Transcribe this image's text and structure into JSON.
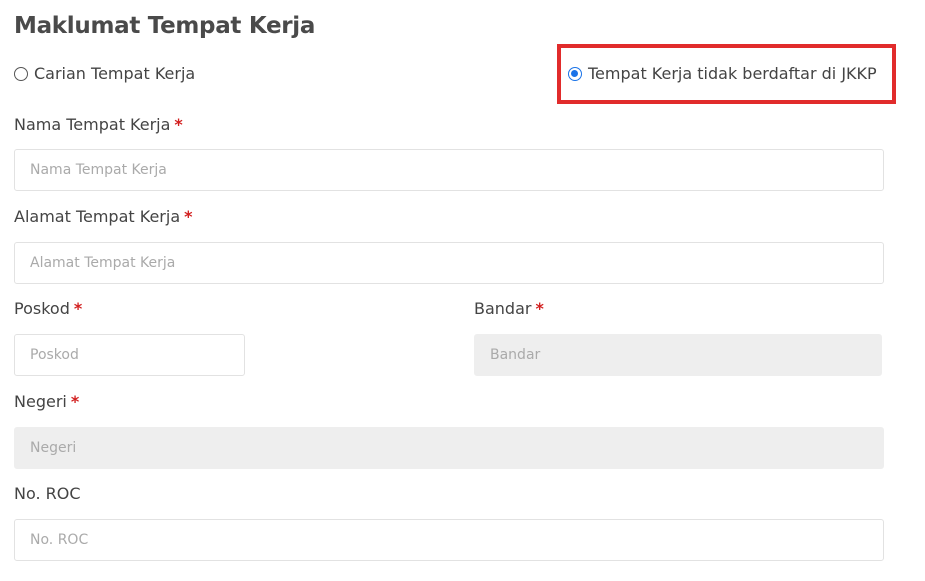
{
  "section": {
    "title": "Maklumat Tempat Kerja"
  },
  "workplace_options": {
    "search": {
      "label": "Carian Tempat Kerja",
      "checked": false
    },
    "unregistered": {
      "label": "Tempat Kerja tidak berdaftar di JKKP",
      "checked": true
    }
  },
  "fields": {
    "nama": {
      "label": "Nama Tempat Kerja",
      "required": "*",
      "placeholder": "Nama Tempat Kerja",
      "value": ""
    },
    "alamat": {
      "label": "Alamat Tempat Kerja",
      "required": "*",
      "placeholder": "Alamat Tempat Kerja",
      "value": ""
    },
    "poskod": {
      "label": "Poskod",
      "required": "*",
      "placeholder": "Poskod",
      "value": ""
    },
    "bandar": {
      "label": "Bandar",
      "required": "*",
      "placeholder": "Bandar",
      "value": ""
    },
    "negeri": {
      "label": "Negeri",
      "required": "*",
      "placeholder": "Negeri",
      "value": ""
    },
    "roc": {
      "label": "No. ROC",
      "placeholder": "No. ROC",
      "value": ""
    }
  },
  "colors": {
    "required_star": "#d21f1f",
    "highlight_border": "#e12b2b",
    "radio_selected": "#1a73e8",
    "disabled_bg": "#eeeeee"
  }
}
